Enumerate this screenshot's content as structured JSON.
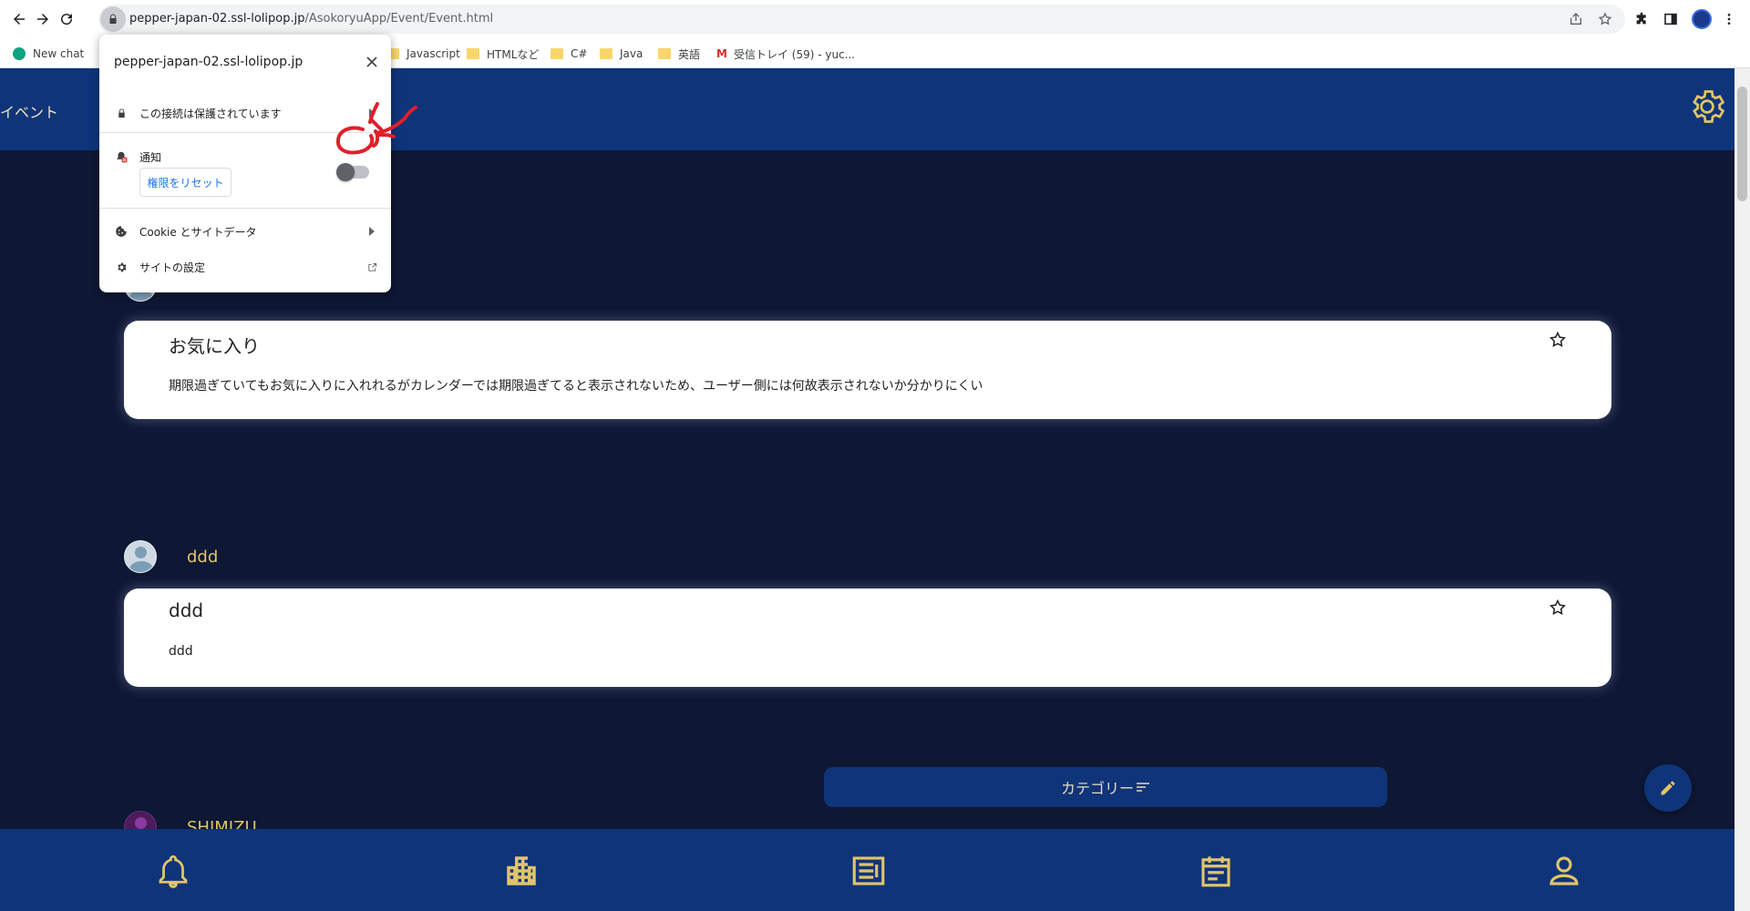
{
  "browser": {
    "url_host": "pepper-japan-02.ssl-lolipop.jp",
    "url_path": "/AsokoryuApp/Event/Event.html",
    "bookmarks": [
      {
        "label": "New chat",
        "kind": "chatgpt"
      },
      {
        "label": "Javascript",
        "kind": "folder"
      },
      {
        "label": "HTMLなど",
        "kind": "folder"
      },
      {
        "label": "C#",
        "kind": "folder"
      },
      {
        "label": "Java",
        "kind": "folder"
      },
      {
        "label": "英語",
        "kind": "folder"
      },
      {
        "label": "受信トレイ (59) - yuc...",
        "kind": "gmail"
      }
    ]
  },
  "popup": {
    "host": "pepper-japan-02.ssl-lolipop.jp",
    "connection_label": "この接続は保護されています",
    "notification_label": "通知",
    "notification_enabled": false,
    "reset_button": "権限をリセット",
    "cookie_label": "Cookie とサイトデータ",
    "site_settings_label": "サイトの設定"
  },
  "app": {
    "title": "イベント",
    "category_button": "カテゴリー",
    "colors": {
      "header": "#0f3479",
      "background": "#0e1733",
      "accent": "#e1c46a",
      "annotation": "#e0202b"
    }
  },
  "posts": [
    {
      "user": "",
      "title": "お気に入り",
      "body": "期限過ぎていてもお気に入りに入れれるがカレンダーでは期限過ぎてると表示されないため、ユーザー側には何故表示されないか分かりにくい"
    },
    {
      "user": "ddd",
      "title": "ddd",
      "body": "ddd"
    },
    {
      "user": "SHIMIZU",
      "title": "",
      "body": ""
    }
  ],
  "bottom_nav": [
    "bell-icon",
    "building-icon",
    "article-icon",
    "calendar-icon",
    "person-icon"
  ]
}
